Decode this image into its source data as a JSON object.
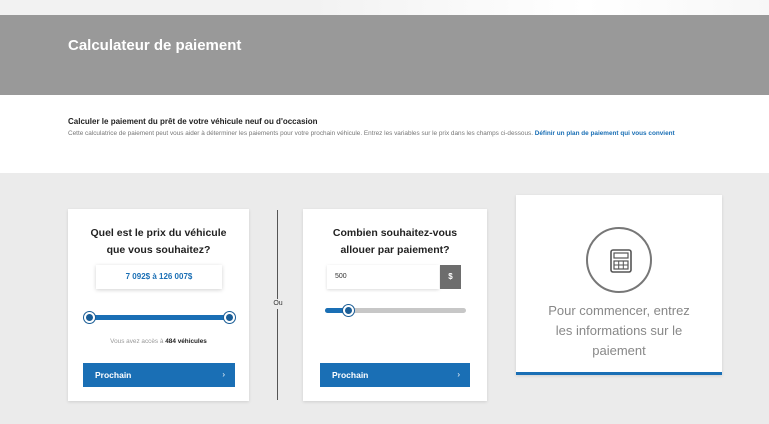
{
  "header": {
    "title": "Calculateur de paiement"
  },
  "intro": {
    "heading": "Calculer le paiement du prêt de votre véhicule neuf ou d'occasion",
    "text": "Cette calculatrice de paiement peut vous aider à déterminer les paiements pour votre prochain véhicule. Entrez les variables sur le prix dans les champs ci-dessous. ",
    "link": "Définir un plan de paiement qui vous convient"
  },
  "price_card": {
    "question_line1": "Quel est le prix du véhicule",
    "question_line2": "que vous souhaitez?",
    "range_text": "7 092$  à 126 007$",
    "slider_min_fraction": 0,
    "slider_max_fraction": 1,
    "access_prefix": "Vous avez accès à ",
    "vehicle_count": "484 véhicules",
    "button_label": "Prochain",
    "button_chevron": "›"
  },
  "separator": {
    "label": "Ou"
  },
  "payment_card": {
    "question_line1": "Combien souhaitez-vous",
    "question_line2": "allouer par paiement?",
    "amount_value": "500",
    "currency": "$",
    "slider_fraction": 0.16,
    "button_label": "Prochain",
    "button_chevron": "›"
  },
  "info_card": {
    "icon": "calculator-icon",
    "message_line1": "Pour commencer, entrez",
    "message_line2": "les informations sur le",
    "message_line3": "paiement"
  },
  "colors": {
    "accent": "#1a6fb5",
    "header_bg": "#999999",
    "page_bg": "#ebebeb"
  }
}
